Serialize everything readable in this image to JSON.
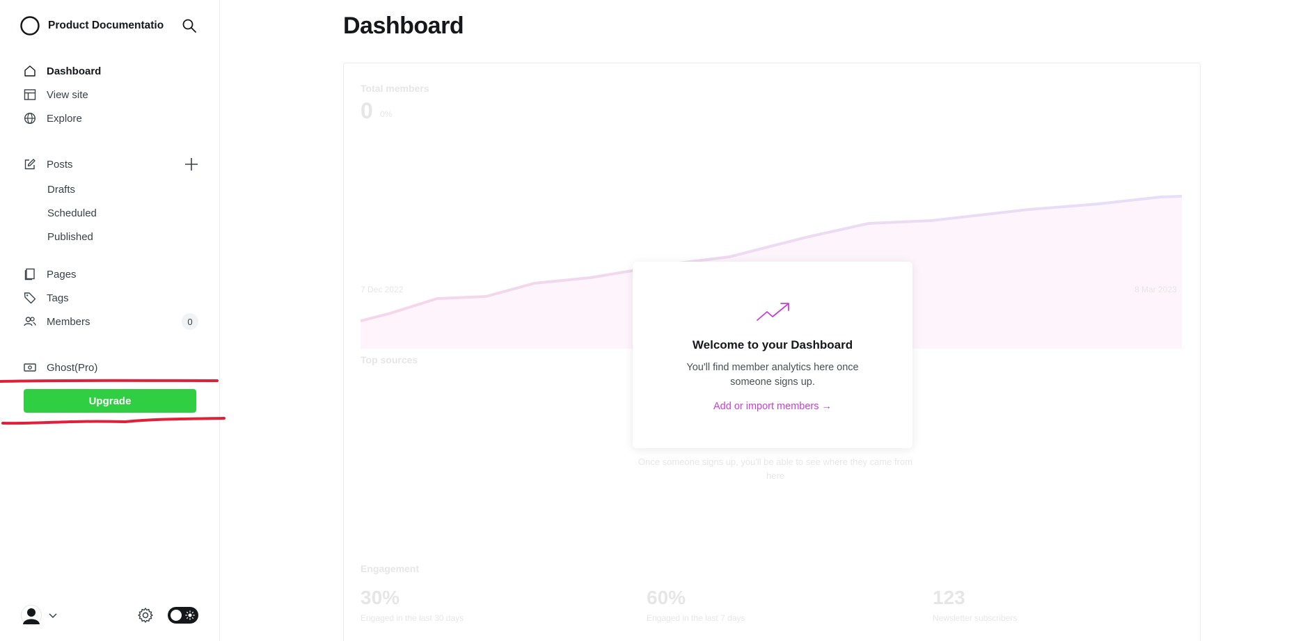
{
  "sidebar": {
    "site_name": "Product Documentatio",
    "nav": {
      "dashboard": "Dashboard",
      "view_site": "View site",
      "explore": "Explore",
      "posts": "Posts",
      "drafts": "Drafts",
      "scheduled": "Scheduled",
      "published": "Published",
      "pages": "Pages",
      "tags": "Tags",
      "members": "Members",
      "members_count": "0",
      "ghost_pro": "Ghost(Pro)"
    },
    "upgrade_label": "Upgrade"
  },
  "main": {
    "title": "Dashboard",
    "background": {
      "total_members_label": "Total members",
      "total_members_value": "0",
      "total_members_change": "0%",
      "date_start": "7 Dec 2022",
      "date_end": "8 Mar 2023",
      "top_sources_label": "Top sources",
      "sources_empty": "Once someone signs up, you'll be able to see where they came from here",
      "engagement_label": "Engagement",
      "metrics": [
        {
          "value": "30%",
          "caption": "Engaged in the last 30 days"
        },
        {
          "value": "60%",
          "caption": "Engaged in the last 7 days"
        },
        {
          "value": "123",
          "caption": "Newsletter subscribers"
        }
      ]
    },
    "welcome": {
      "title": "Welcome to your Dashboard",
      "body": "You'll find member analytics here once someone signs up.",
      "link": "Add or import members →"
    }
  },
  "colors": {
    "accent": "#c73ed6",
    "upgrade": "#30cf43",
    "annotation": "#e0203a"
  }
}
